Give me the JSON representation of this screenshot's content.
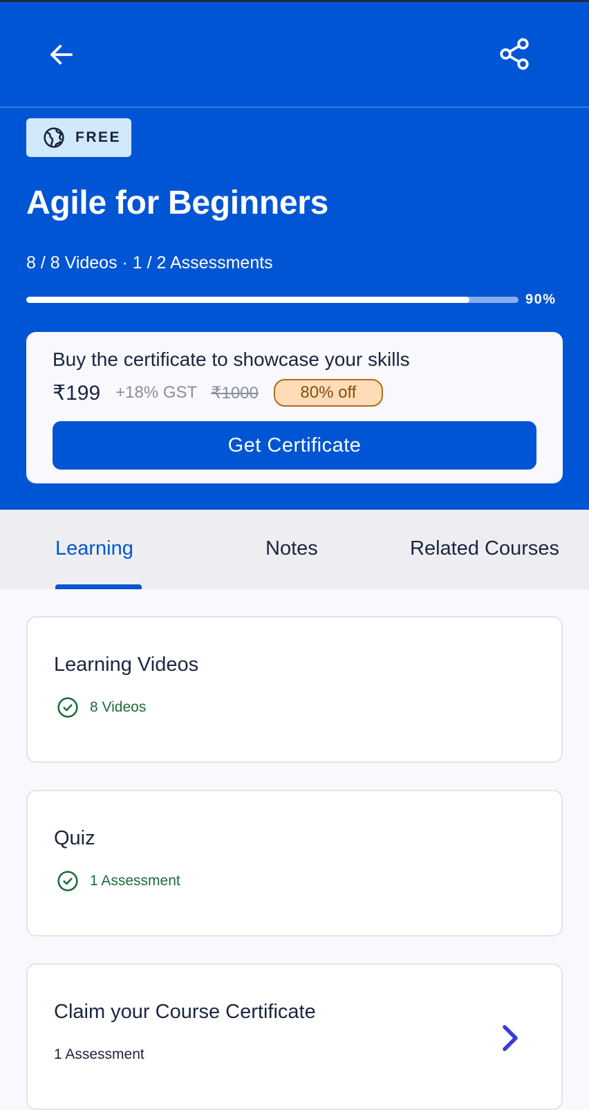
{
  "header": {
    "back_icon": "arrow-left-icon",
    "share_icon": "share-icon",
    "badge_icon": "globe-icon",
    "badge_label": "FREE"
  },
  "course": {
    "title": "Agile for Beginners",
    "meta": "8 / 8 Videos · 1 / 2 Assessments",
    "progress_fraction": 0.9,
    "progress_label": "90%"
  },
  "certificate_promo": {
    "heading": "Buy the certificate to showcase your skills",
    "price": "₹199",
    "gst": "+18% GST",
    "original_price": "₹1000",
    "discount": "80% off",
    "cta_label": "Get Certificate"
  },
  "tabs": {
    "items": [
      {
        "label": "Learning",
        "active": true
      },
      {
        "label": "Notes",
        "active": false
      },
      {
        "label": "Related Courses",
        "active": false
      }
    ]
  },
  "sections": [
    {
      "title": "Learning Videos",
      "status": "8 Videos",
      "completed": true,
      "status_icon": "check-circle-icon"
    },
    {
      "title": "Quiz",
      "status": "1 Assessment",
      "completed": true,
      "status_icon": "check-circle-icon"
    },
    {
      "title": "Claim your Course Certificate",
      "status": "1 Assessment",
      "completed": false,
      "action_icon": "chevron-right-icon"
    }
  ],
  "colors": {
    "primary": "#0055d4",
    "success": "#1a6b3a",
    "discount_bg": "#ffdcb8",
    "discount_border": "#b06a1a",
    "badge_bg": "#d2e8fb",
    "chevron": "#3b3bd6"
  }
}
